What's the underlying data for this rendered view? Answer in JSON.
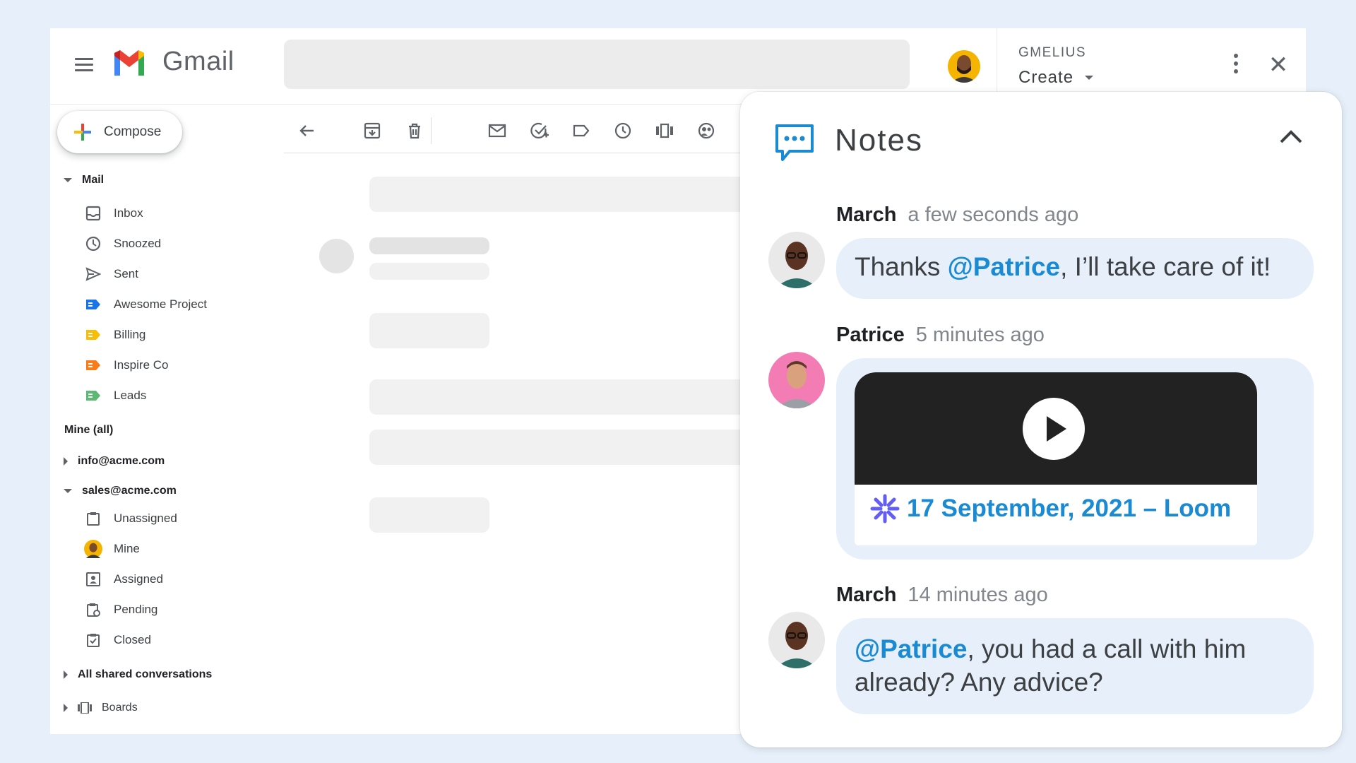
{
  "header": {
    "app_name": "Gmail",
    "search_placeholder": ""
  },
  "gmelius": {
    "title": "GMELIUS",
    "create_label": "Create"
  },
  "sidebar": {
    "compose_label": "Compose",
    "mail_section": "Mail",
    "mail_items": [
      {
        "label": "Inbox",
        "icon": "inbox-icon"
      },
      {
        "label": "Snoozed",
        "icon": "clock-icon"
      },
      {
        "label": "Sent",
        "icon": "send-icon"
      },
      {
        "label": "Awesome Project",
        "icon": "label-icon",
        "color": "#1a73e8"
      },
      {
        "label": "Billing",
        "icon": "label-icon",
        "color": "#fbbc04"
      },
      {
        "label": "Inspire Co",
        "icon": "label-icon",
        "color": "#fa7b17"
      },
      {
        "label": "Leads",
        "icon": "label-icon",
        "color": "#5bb974"
      }
    ],
    "mine_all": "Mine (all)",
    "info_account": "info@acme.com",
    "sales_account": "sales@acme.com",
    "sales_items": [
      {
        "label": "Unassigned",
        "icon": "clipboard-icon"
      },
      {
        "label": "Mine",
        "icon": "avatar"
      },
      {
        "label": "Assigned",
        "icon": "assigned-icon"
      },
      {
        "label": "Pending",
        "icon": "pending-icon"
      },
      {
        "label": "Closed",
        "icon": "closed-icon"
      }
    ],
    "shared": "All shared conversations",
    "boards": "Boards"
  },
  "toolbar": {
    "icons": [
      "back-arrow-icon",
      "archive-icon",
      "delete-icon",
      "mail-icon",
      "add-task-icon",
      "label-icon",
      "snooze-icon",
      "boards-icon",
      "assign-icon"
    ]
  },
  "notes": {
    "title": "Notes",
    "messages": [
      {
        "author": "March",
        "time": "a few seconds ago",
        "mention": "@Patrice",
        "text": ", I’ll take care of it!",
        "prefix": "Thanks "
      },
      {
        "author": "Patrice",
        "time": "5 minutes ago",
        "video_label": "17 September, 2021 – Loom"
      },
      {
        "author": "March",
        "time": "14 minutes ago",
        "mention": "@Patrice",
        "text": ", you had a call with him already? Any advice?"
      }
    ]
  },
  "colors": {
    "accent": "#1a8ad3",
    "background": "#e7f0fa",
    "bubble": "#e7f0fa"
  }
}
